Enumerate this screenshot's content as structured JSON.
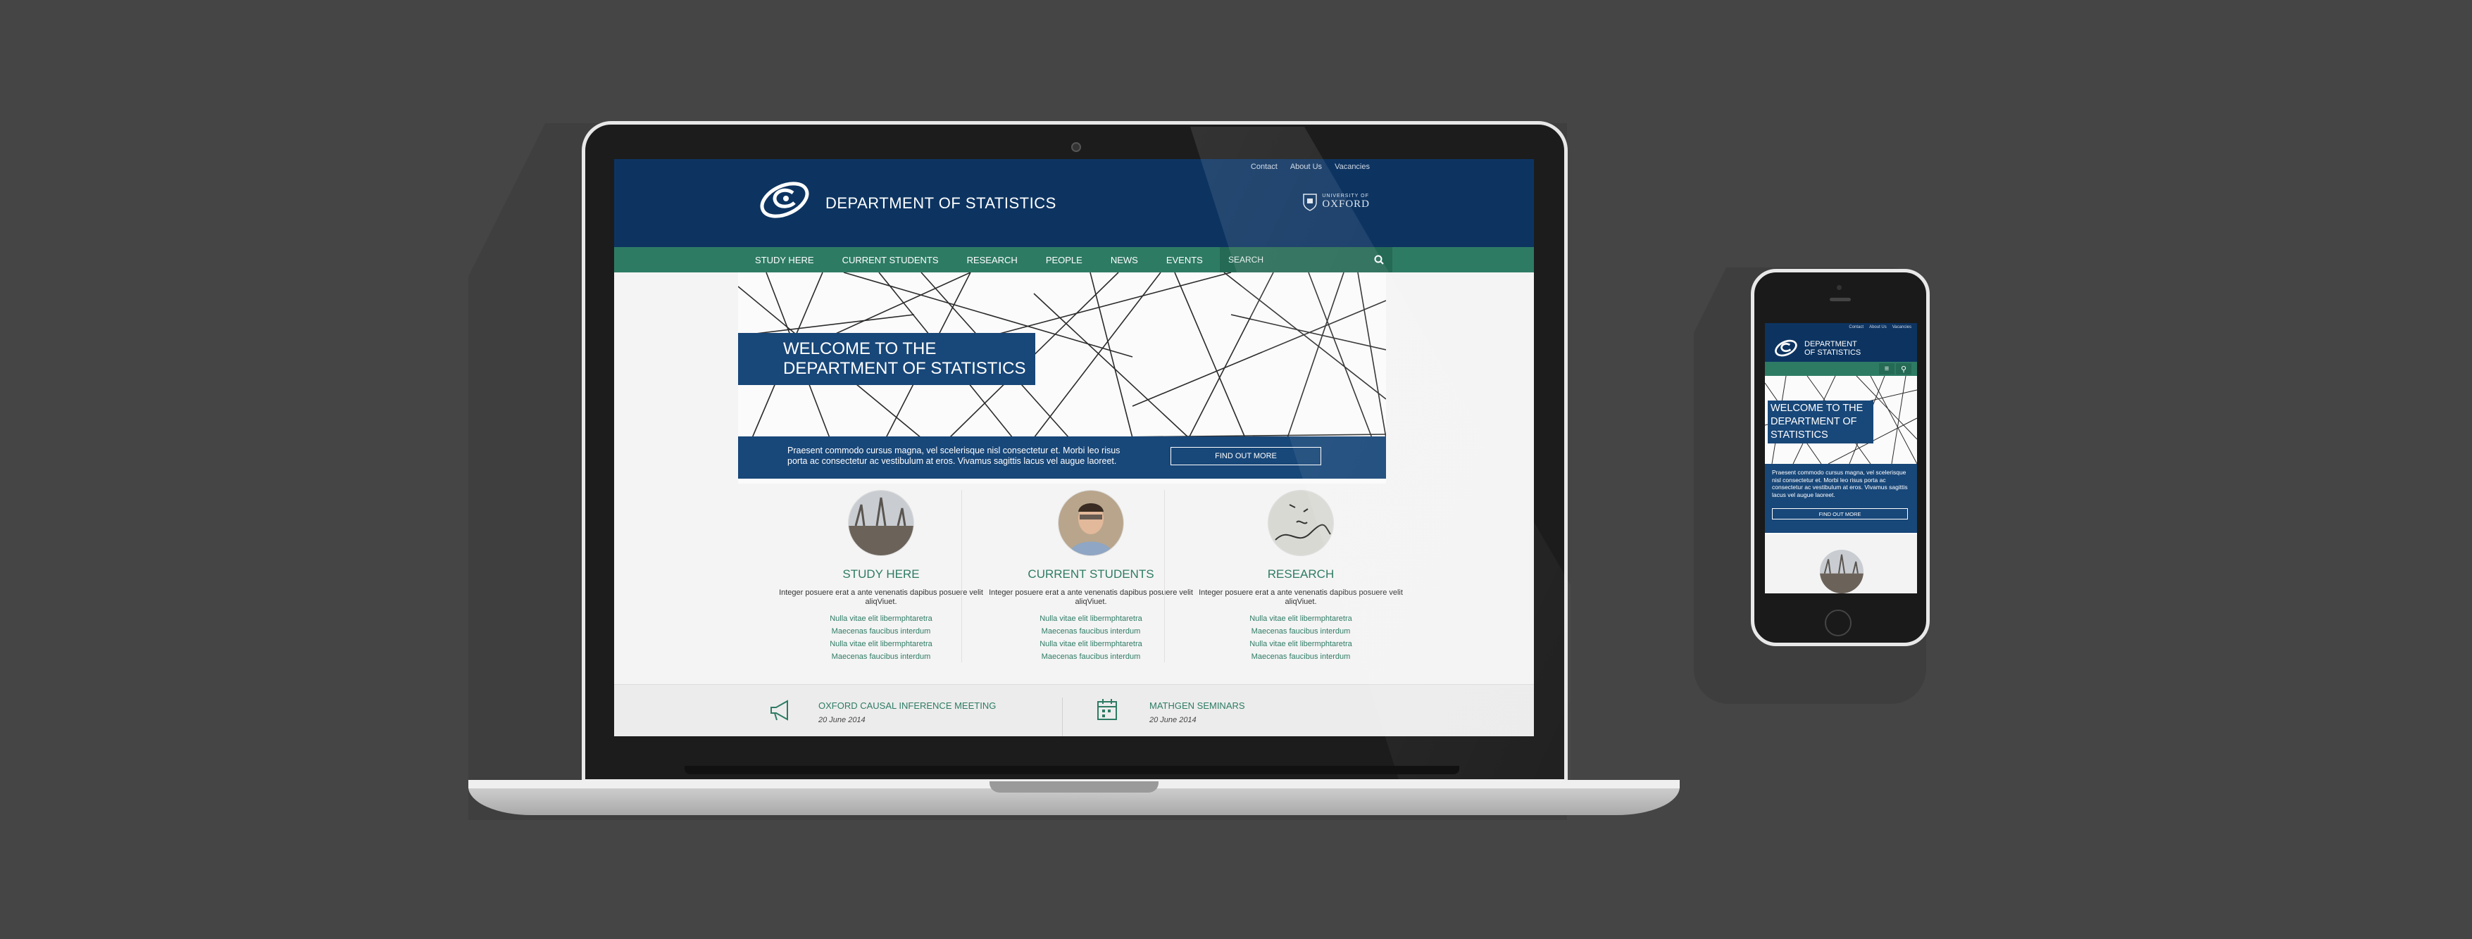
{
  "site": {
    "top_links": [
      "Contact",
      "About Us",
      "Vacancies"
    ],
    "title": "DEPARTMENT OF STATISTICS",
    "oxford_small": "UNIVERSITY OF",
    "oxford_big": "OXFORD",
    "nav": [
      "STUDY HERE",
      "CURRENT STUDENTS",
      "RESEARCH",
      "PEOPLE",
      "NEWS",
      "EVENTS"
    ],
    "search_placeholder": "SEARCH",
    "hero": {
      "line1": "WELCOME TO THE",
      "line2": "DEPARTMENT OF STATISTICS",
      "text": "Praesent commodo cursus magna, vel scelerisque nisl consectetur et. Morbi leo risus porta ac consectetur ac vestibulum at eros. Vivamus sagittis lacus vel augue laoreet.",
      "button": "FIND OUT MORE"
    },
    "columns": [
      {
        "heading": "STUDY HERE",
        "text": "Integer posuere erat a ante venenatis dapibus posuere velit aliqViuet.",
        "links": [
          "Nulla vitae elit libermphtaretra",
          "Maecenas faucibus interdum",
          "Nulla vitae elit libermphtaretra",
          "Maecenas faucibus interdum"
        ]
      },
      {
        "heading": "CURRENT STUDENTS",
        "text": "Integer posuere erat a ante venenatis dapibus posuere velit aliqViuet.",
        "links": [
          "Nulla vitae elit libermphtaretra",
          "Maecenas faucibus interdum",
          "Nulla vitae elit libermphtaretra",
          "Maecenas faucibus interdum"
        ]
      },
      {
        "heading": "RESEARCH",
        "text": "Integer posuere erat a ante venenatis dapibus posuere velit aliqViuet.",
        "links": [
          "Nulla vitae elit libermphtaretra",
          "Maecenas faucibus interdum",
          "Nulla vitae elit libermphtaretra",
          "Maecenas faucibus interdum"
        ]
      }
    ],
    "events": [
      {
        "title": "OXFORD CAUSAL INFERENCE MEETING",
        "date": "20 June 2014",
        "icon": "megaphone-icon"
      },
      {
        "title": "MATHGEN SEMINARS",
        "date": "20 June 2014",
        "icon": "calendar-icon"
      }
    ]
  },
  "mobile": {
    "top_links": [
      "Contact",
      "About Us",
      "Vacancies"
    ],
    "title_line1": "DEPARTMENT",
    "title_line2": "OF STATISTICS",
    "hero_lines": [
      "WELCOME TO THE",
      "DEPARTMENT OF",
      "STATISTICS"
    ],
    "hero_text": "Praesent commodo cursus magna, vel scelerisque nisl consectetur et. Morbi leo risus porta ac consectetur ac vestibulum at eros. Vivamus sagittis lacus vel augue laoreet.",
    "button": "FIND OUT MORE",
    "menu_icon": "≡",
    "search_icon": "⚲"
  },
  "colors": {
    "background": "#454545",
    "navy": "#0d3461",
    "hero_blue": "#184779",
    "green": "#2e7b64"
  }
}
